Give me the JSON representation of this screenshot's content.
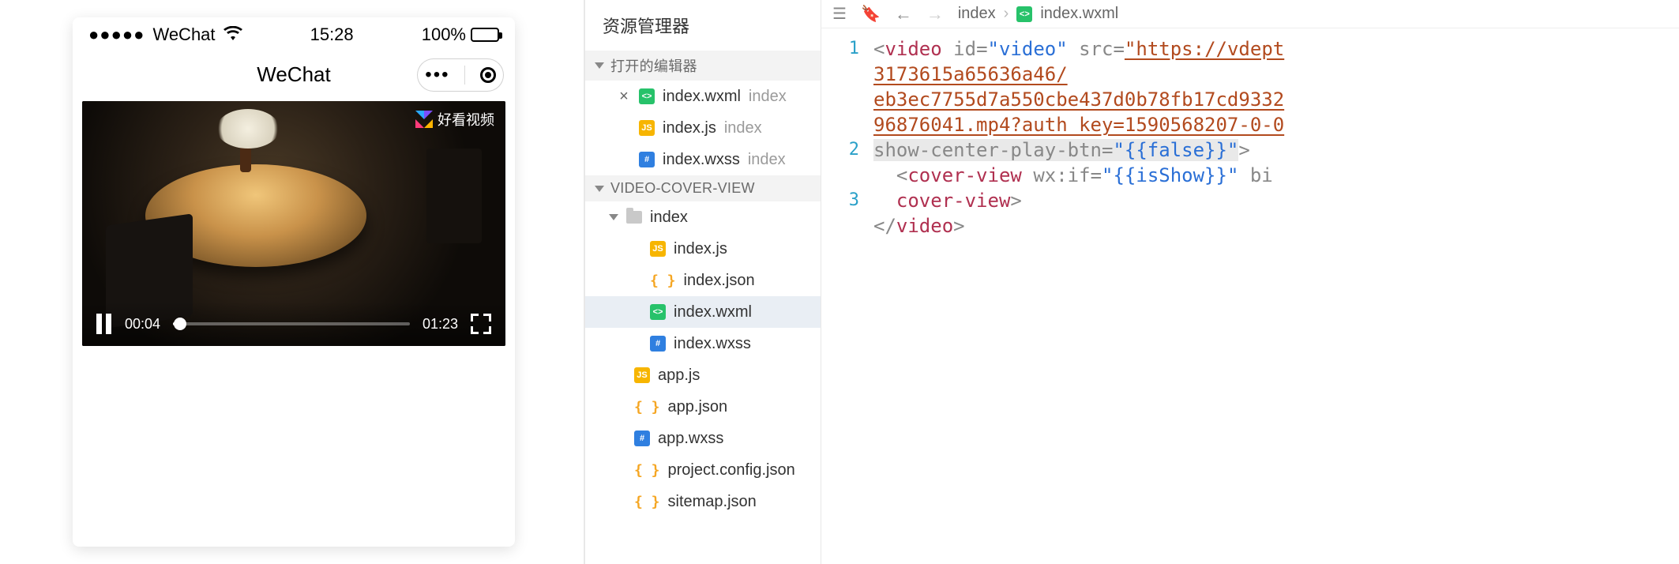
{
  "simulator": {
    "carrier": "WeChat",
    "signal_dots": "●●●●●",
    "time": "15:28",
    "battery_pct": "100%",
    "nav_title": "WeChat",
    "capsule_menu": "•••",
    "video": {
      "watermark": "好看视频",
      "watermark_name": "haokan-video-logo",
      "current_time": "00:04",
      "duration": "01:23"
    }
  },
  "explorer": {
    "title": "资源管理器",
    "open_editors_label": "打开的编辑器",
    "project_label": "VIDEO-COVER-VIEW",
    "open_editors": [
      {
        "name": "index.wxml",
        "dir": "index",
        "icon": "wxml",
        "closeable": true,
        "active": false
      },
      {
        "name": "index.js",
        "dir": "index",
        "icon": "js",
        "closeable": false,
        "active": false
      },
      {
        "name": "index.wxss",
        "dir": "index",
        "icon": "wxss",
        "closeable": false,
        "active": false
      }
    ],
    "tree_folder": "index",
    "tree_index_files": [
      {
        "name": "index.js",
        "icon": "js"
      },
      {
        "name": "index.json",
        "icon": "json"
      },
      {
        "name": "index.wxml",
        "icon": "wxml",
        "active": true
      },
      {
        "name": "index.wxss",
        "icon": "wxss"
      }
    ],
    "root_files": [
      {
        "name": "app.js",
        "icon": "js"
      },
      {
        "name": "app.json",
        "icon": "json"
      },
      {
        "name": "app.wxss",
        "icon": "wxss"
      },
      {
        "name": "project.config.json",
        "icon": "json"
      },
      {
        "name": "sitemap.json",
        "icon": "json"
      }
    ]
  },
  "editor": {
    "breadcrumb_root": "index",
    "breadcrumb_file": "index.wxml",
    "line_numbers": [
      "1",
      "2",
      "3"
    ],
    "code": {
      "l1": {
        "tag_open": "video",
        "attr_id": "id",
        "val_id": "\"video\"",
        "attr_src": "src",
        "url_part1": "\"https://vdept",
        "url_part2": "3173615a65636a46/",
        "url_part3": "eb3ec7755d7a550cbe437d0b78fb17cd9332",
        "url_part4": "96876041.mp4?auth_key=1590568207-0-0",
        "attr_scpb": "show-center-play-btn",
        "val_scpb": "\"{{false}}\""
      },
      "l2": {
        "tag_open": "cover-view",
        "attr_wxif": "wx:if",
        "val_wxif": "\"{{isShow}}\"",
        "attr_bind": "bi",
        "tag_close": "cover-view"
      },
      "l3": {
        "tag_close": "video"
      }
    }
  },
  "colors": {
    "wxml": "#27c26a",
    "js": "#f7b500",
    "wxss": "#2f7fe0",
    "json": "#f5a623"
  }
}
